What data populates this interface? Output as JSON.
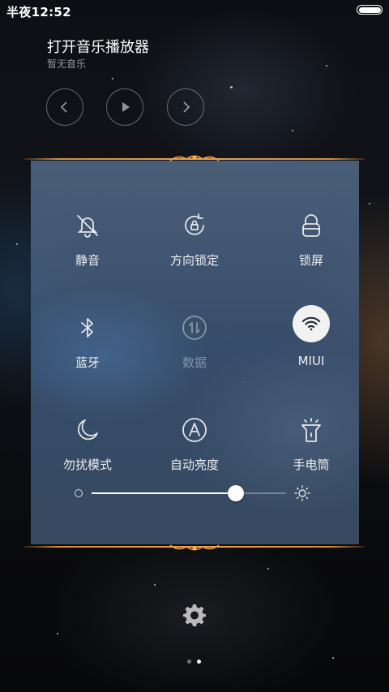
{
  "status_bar": {
    "time": "半夜12:52",
    "battery_icon": "battery-full-icon"
  },
  "music": {
    "title": "打开音乐播放器",
    "subtitle": "暂无音乐",
    "controls": [
      "previous-icon",
      "play-icon",
      "next-icon"
    ]
  },
  "toggles": [
    {
      "label": "静音",
      "icon": "bell-off-icon",
      "state": "off"
    },
    {
      "label": "方向锁定",
      "icon": "rotation-lock-icon",
      "state": "off"
    },
    {
      "label": "锁屏",
      "icon": "lock-icon",
      "state": "off"
    },
    {
      "label": "蓝牙",
      "icon": "bluetooth-icon",
      "state": "off"
    },
    {
      "label": "数据",
      "icon": "mobile-data-icon",
      "state": "disabled"
    },
    {
      "label": "MIUI",
      "icon": "wifi-icon",
      "state": "on"
    },
    {
      "label": "勿扰模式",
      "icon": "moon-icon",
      "state": "off"
    },
    {
      "label": "自动亮度",
      "icon": "auto-brightness-icon",
      "state": "off"
    },
    {
      "label": "手电筒",
      "icon": "flashlight-icon",
      "state": "off"
    }
  ],
  "brightness": {
    "value": 0.74,
    "min_icon": "brightness-low-icon",
    "max_icon": "brightness-high-icon"
  },
  "settings_icon": "gear-icon",
  "pager": {
    "count": 2,
    "active": 1
  },
  "colors": {
    "accent_ornament": "#e08a2a",
    "panel": "#52688a",
    "active_toggle_bg": "#f2f2f2"
  }
}
